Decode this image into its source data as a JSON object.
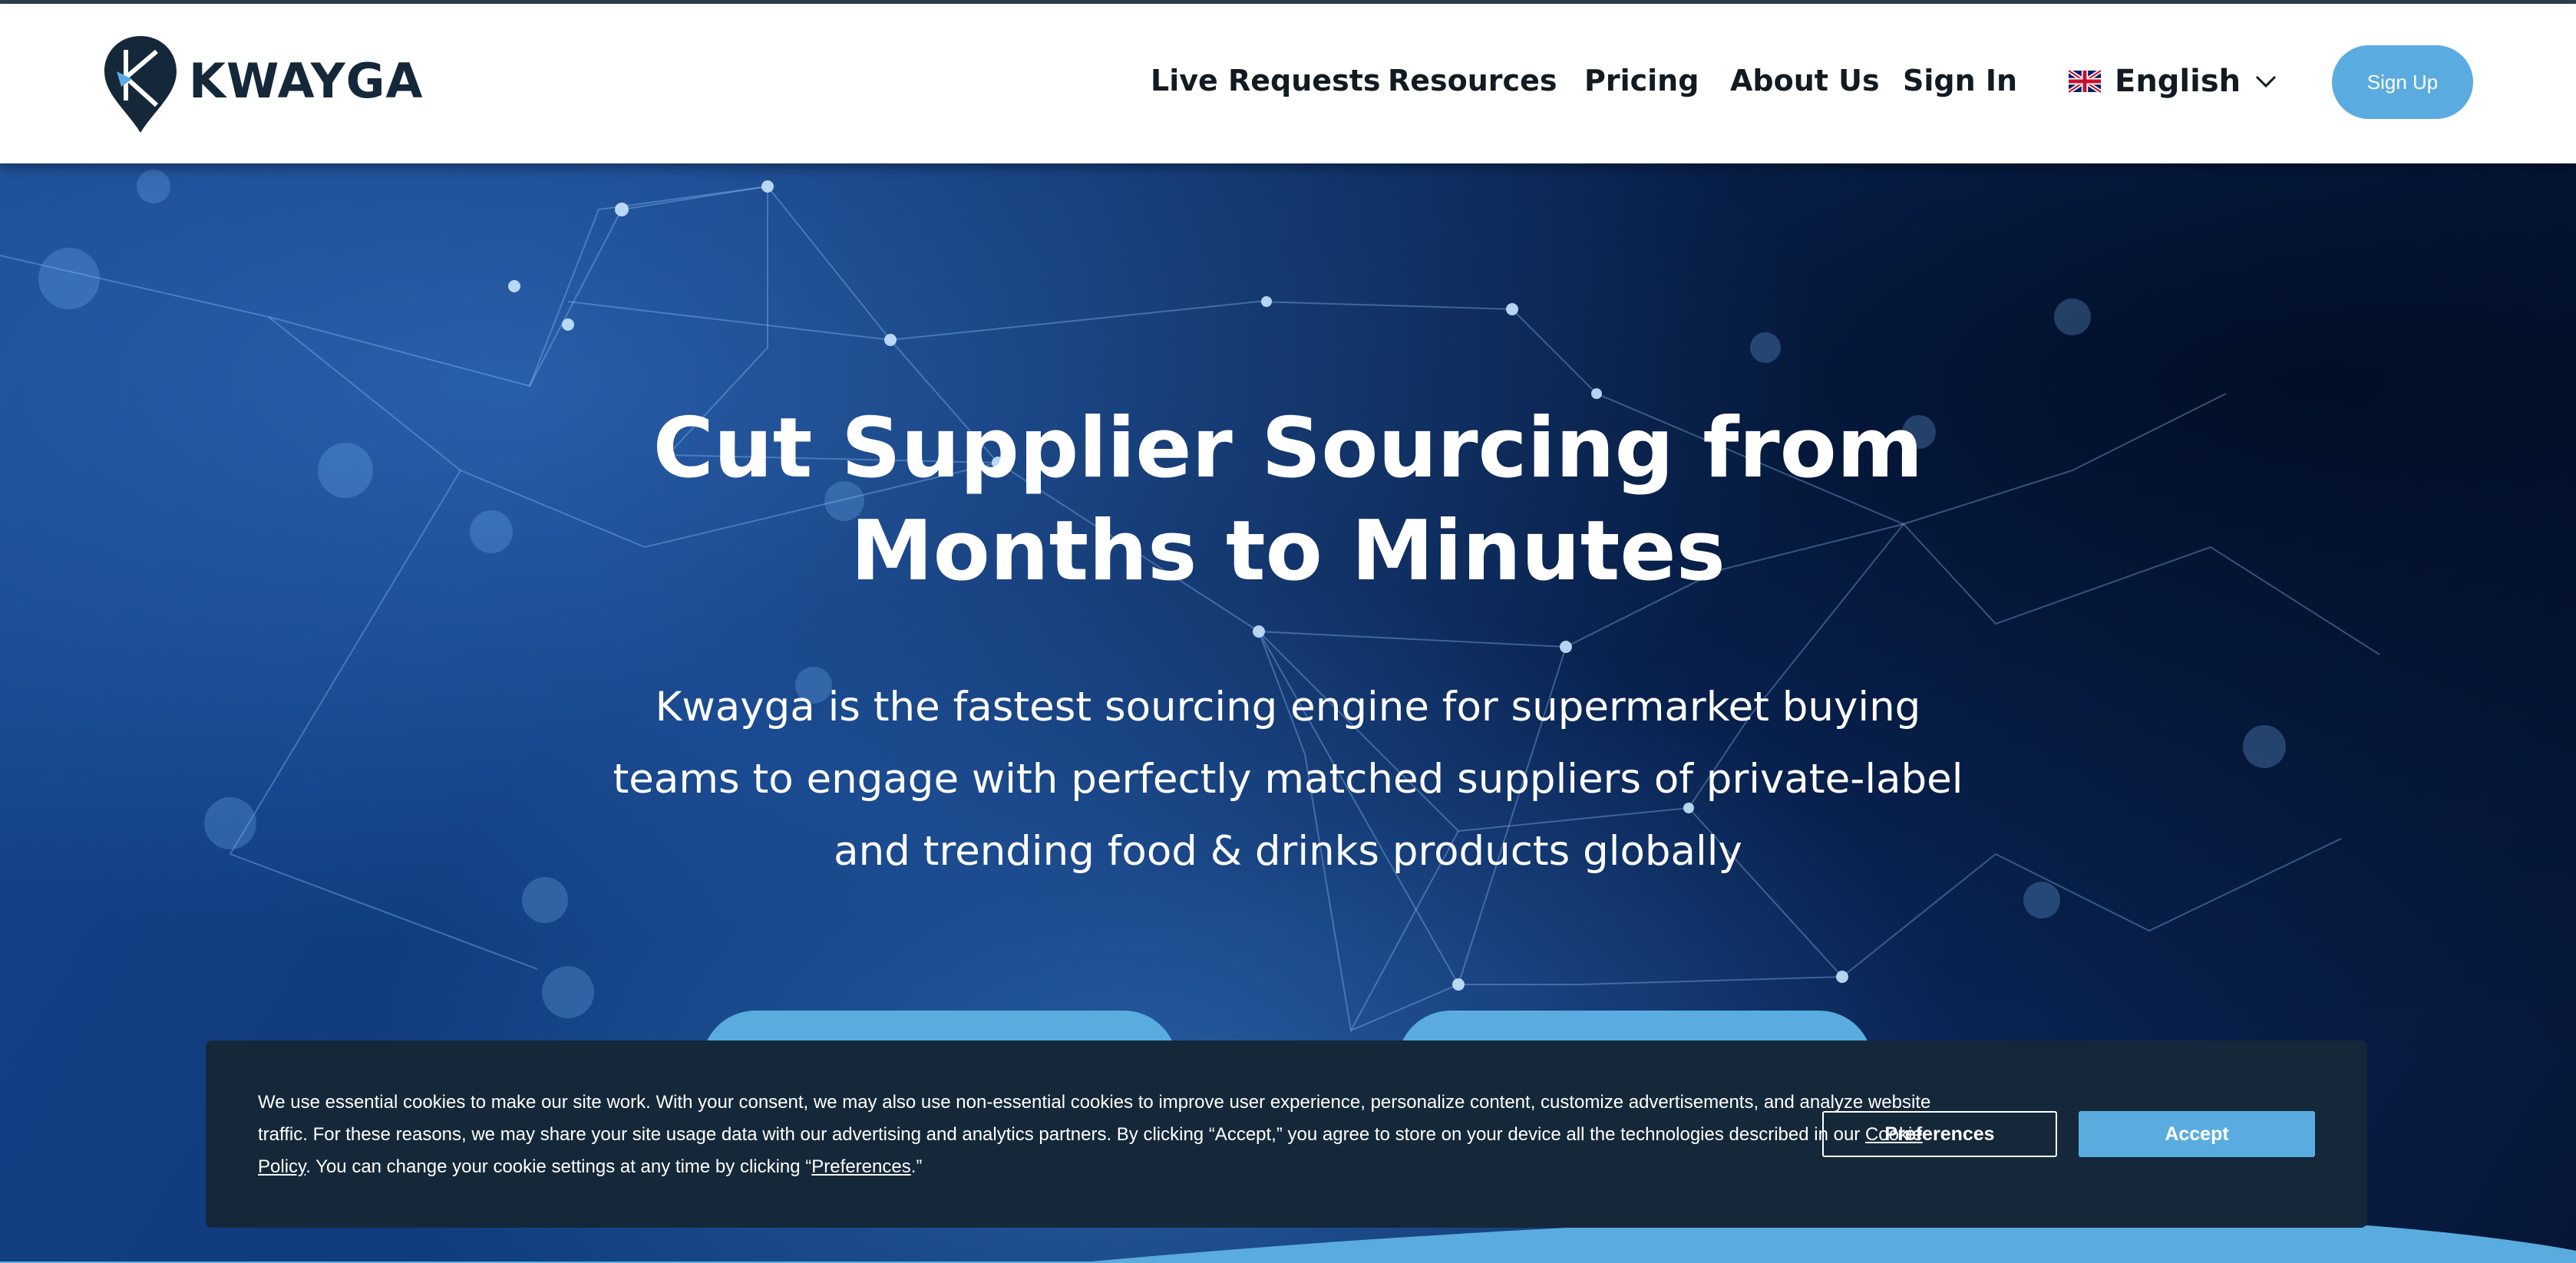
{
  "brand": {
    "name": "KWAYGA"
  },
  "nav": {
    "items": [
      "Live Requests",
      "Resources",
      "Pricing",
      "About Us",
      "Sign In"
    ],
    "language": "English",
    "signup": "Sign Up"
  },
  "hero": {
    "title_line1": "Cut Supplier Sourcing from",
    "title_line2": "Months to Minutes",
    "subtitle": "Kwayga is the fastest sourcing engine for supermarket buying teams to engage with perfectly matched suppliers of private-label and trending food & drinks products globally"
  },
  "cookie": {
    "text_part1": "We use essential cookies to make our site work. With your consent, we may also use non-essential cookies to improve user experience, personalize content, customize advertisements, and analyze website traffic. For these reasons, we may share your site usage data with our advertising and analytics partners. By clicking “Accept,” you agree to store on your device all the technologies described in our ",
    "link_policy": "Cookie Policy",
    "text_part2": ". You can change your cookie settings at any time by clicking “",
    "link_preferences": "Preferences",
    "text_part3": ".”",
    "btn_preferences": "Preferences",
    "btn_accept": "Accept"
  },
  "colors": {
    "accent": "#5aace0",
    "dark_navy": "#14283a",
    "hero_blue": "#0f3a7c"
  },
  "icons": [
    "kwayga-logo-icon",
    "uk-flag-icon",
    "chevron-down-icon"
  ]
}
